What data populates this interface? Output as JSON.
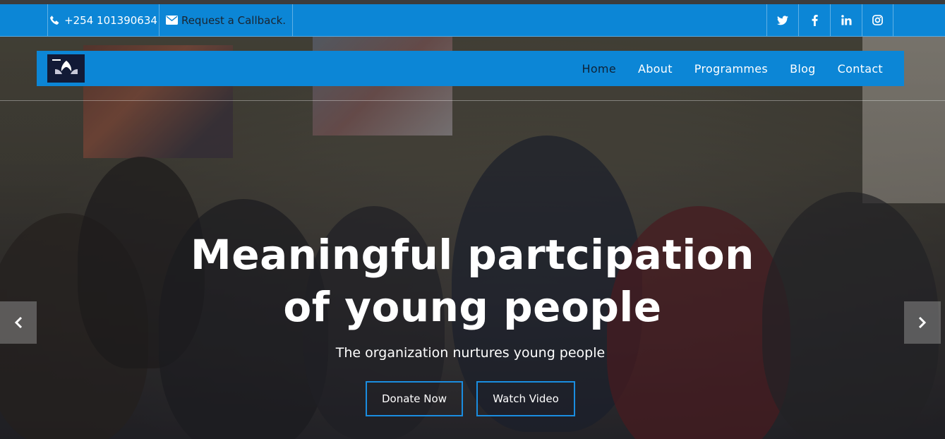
{
  "topbar": {
    "phone": "+254 101390634",
    "callback": "Request a Callback.",
    "social": [
      "twitter-icon",
      "facebook-icon",
      "linkedin-icon",
      "instagram-icon"
    ]
  },
  "navbar": {
    "logo_icon": "organization-logo",
    "items": [
      {
        "label": "Home",
        "active": true
      },
      {
        "label": "About"
      },
      {
        "label": "Programmes"
      },
      {
        "label": "Blog"
      },
      {
        "label": "Contact"
      }
    ]
  },
  "hero": {
    "headline_line1": "Meaningful partcipation",
    "headline_line2": "of young people",
    "subtitle": "The organization nurtures young people",
    "donate_label": "Donate Now",
    "video_label": "Watch Video"
  },
  "colors": {
    "brand_blue": "#0c86d6",
    "button_border": "#1a8de0",
    "active_nav_text": "#0f2236"
  }
}
